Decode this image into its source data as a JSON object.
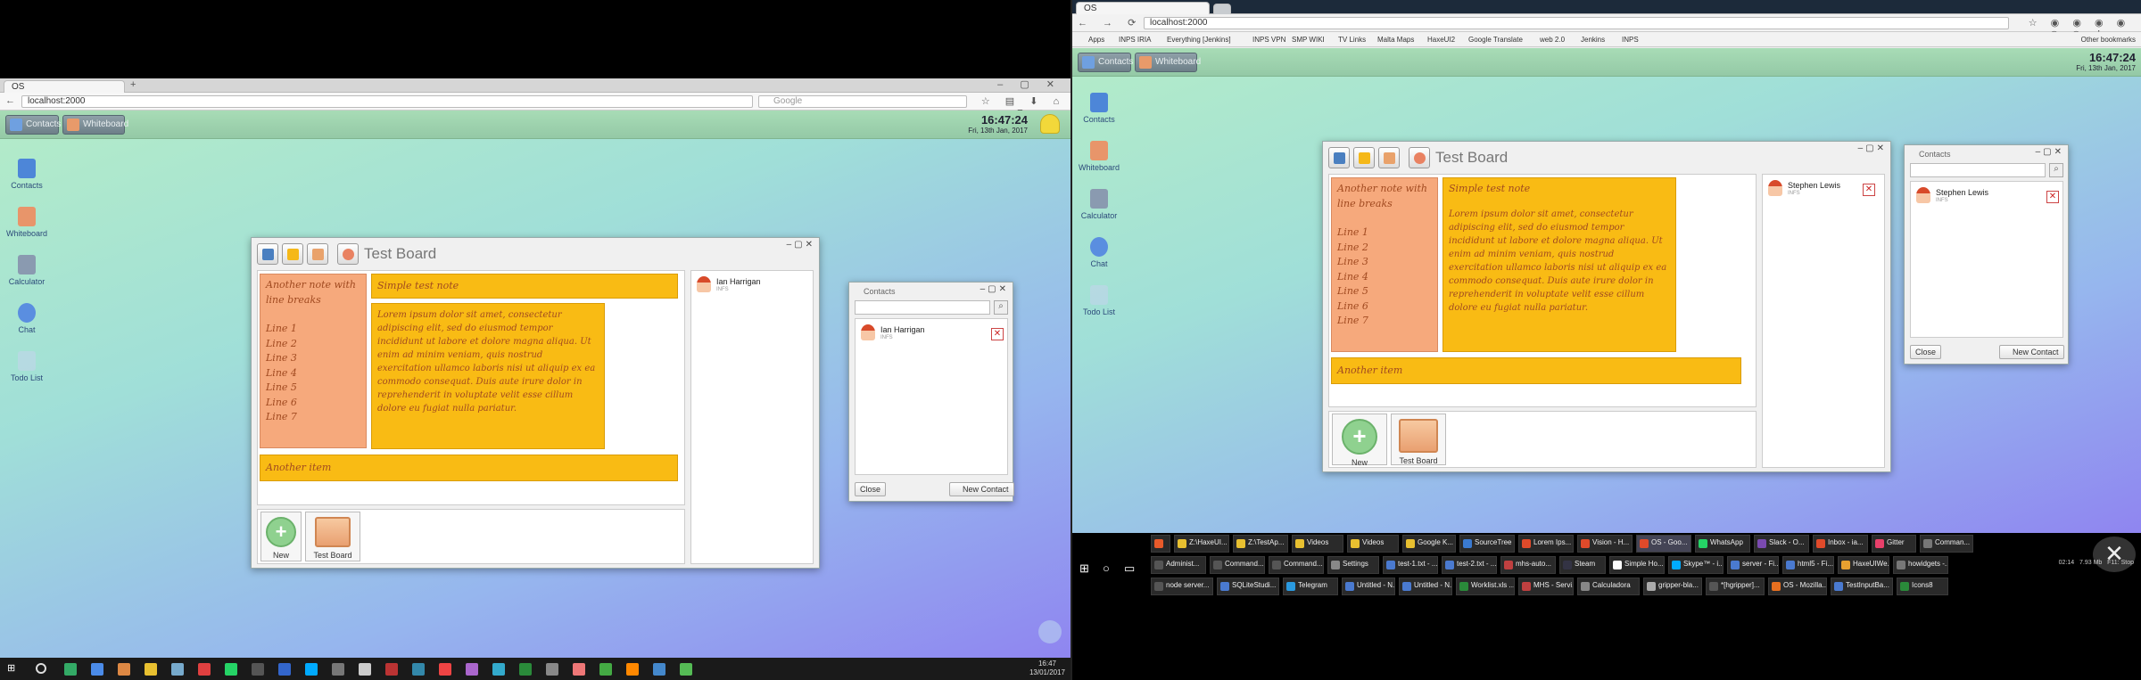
{
  "left": {
    "browser": {
      "tab_title": "OS",
      "url": "localhost:2000",
      "search_placeholder": "Google"
    },
    "app": {
      "toolbar": [
        {
          "label": "Contacts"
        },
        {
          "label": "Whiteboard"
        }
      ],
      "clock_time": "16:47:24",
      "clock_date": "Fri, 13th Jan, 2017",
      "desktop_icons": [
        {
          "label": "Contacts"
        },
        {
          "label": "Whiteboard"
        },
        {
          "label": "Calculator"
        },
        {
          "label": "Chat"
        },
        {
          "label": "Todo List"
        }
      ],
      "board": {
        "title": "Test Board",
        "note_breaks_title": "Another note with line breaks",
        "note_breaks_lines": [
          "Line 1",
          "Line 2",
          "Line 3",
          "Line 4",
          "Line 5",
          "Line 6",
          "Line 7"
        ],
        "note_simple": "Simple test note",
        "note_lorem": "Lorem ipsum dolor sit amet, consectetur adipiscing elit, sed do eiusmod tempor incididunt ut labore et dolore magna aliqua. Ut enim ad minim veniam, quis nostrud exercitation ullamco laboris nisi ut aliquip ex ea commodo consequat. Duis aute irure dolor in reprehenderit in voluptate velit esse cillum dolore eu fugiat nulla pariatur.",
        "note_item": "Another item",
        "new_label": "New",
        "board_label": "Test Board",
        "user_name": "Ian Harrigan",
        "user_sub": "INFS"
      },
      "contacts": {
        "title": "Contacts",
        "name": "Ian Harrigan",
        "sub": "INFS",
        "close": "Close",
        "new_contact": "New Contact"
      }
    },
    "taskbar": {
      "time": "16:47",
      "date": "13/01/2017"
    }
  },
  "right": {
    "browser": {
      "tab_title": "OS",
      "url": "localhost:2000",
      "bookmarks": [
        "Apps",
        "INPS IRIA",
        "Everything [Jenkins]",
        "INPS VPN",
        "SMP WIKI",
        "TV Links",
        "Malta Maps",
        "HaxeUI2",
        "Google Translate",
        "web 2.0",
        "Jenkins",
        "INPS"
      ],
      "other_bookmarks": "Other bookmarks"
    },
    "app": {
      "toolbar": [
        {
          "label": "Contacts"
        },
        {
          "label": "Whiteboard"
        }
      ],
      "clock_time": "16:47:24",
      "clock_date": "Fri, 13th Jan, 2017",
      "desktop_icons": [
        {
          "label": "Contacts"
        },
        {
          "label": "Whiteboard"
        },
        {
          "label": "Calculator"
        },
        {
          "label": "Chat"
        },
        {
          "label": "Todo List"
        }
      ],
      "board": {
        "title": "Test Board",
        "note_breaks_title": "Another note with line breaks",
        "note_breaks_lines": [
          "Line 1",
          "Line 2",
          "Line 3",
          "Line 4",
          "Line 5",
          "Line 6",
          "Line 7"
        ],
        "note_simple": "Simple test note",
        "note_lorem": "Lorem ipsum dolor sit amet, consectetur adipiscing elit, sed do eiusmod tempor incididunt ut labore et dolore magna aliqua. Ut enim ad minim veniam, quis nostrud exercitation ullamco laboris nisi ut aliquip ex ea commodo consequat. Duis aute irure dolor in reprehenderit in voluptate velit esse cillum dolore eu fugiat nulla pariatur.",
        "note_item": "Another item",
        "new_label": "New",
        "board_label": "Test Board",
        "user_name": "Stephen Lewis",
        "user_sub": "INFS"
      },
      "contacts": {
        "title": "Contacts",
        "name": "Stephen Lewis",
        "sub": "INFS",
        "close": "Close",
        "new_contact": "New Contact"
      }
    },
    "taskbar": {
      "row1": [
        "Administ...",
        "Command...",
        "Command...",
        "Settings",
        "test-1.txt - ...",
        "test-2.txt - ...",
        "mhs-auto...",
        "Steam",
        "Simple Ho...",
        "Skype™ - i...",
        "server - Fi...",
        "html5 - Fi...",
        "HaxeUIWe...",
        "howidgets -..."
      ],
      "row2": [
        "node server...",
        "SQLiteStudi...",
        "Telegram",
        "Untitled - N...",
        "Untitled - N...",
        "Worklist.xls ...",
        "MHS - Servi...",
        "Calculadora",
        "gripper-bla...",
        "*[hgripper]...",
        "OS - Mozilla...",
        "TestInputBa...",
        "Icons8"
      ],
      "row0": [
        "Z:\\HaxeUI...",
        "Z:\\TestAp...",
        "Videos",
        "Videos",
        "Google K...",
        "SourceTree",
        "Lorem Ips...",
        "Vision - H...",
        "OS - Goo...",
        "WhatsApp",
        "Slack - O...",
        "Inbox - ia...",
        "Gitter",
        "Comman..."
      ],
      "status": [
        "02:14",
        "7.93 Mb",
        "F11: Stop"
      ]
    }
  }
}
